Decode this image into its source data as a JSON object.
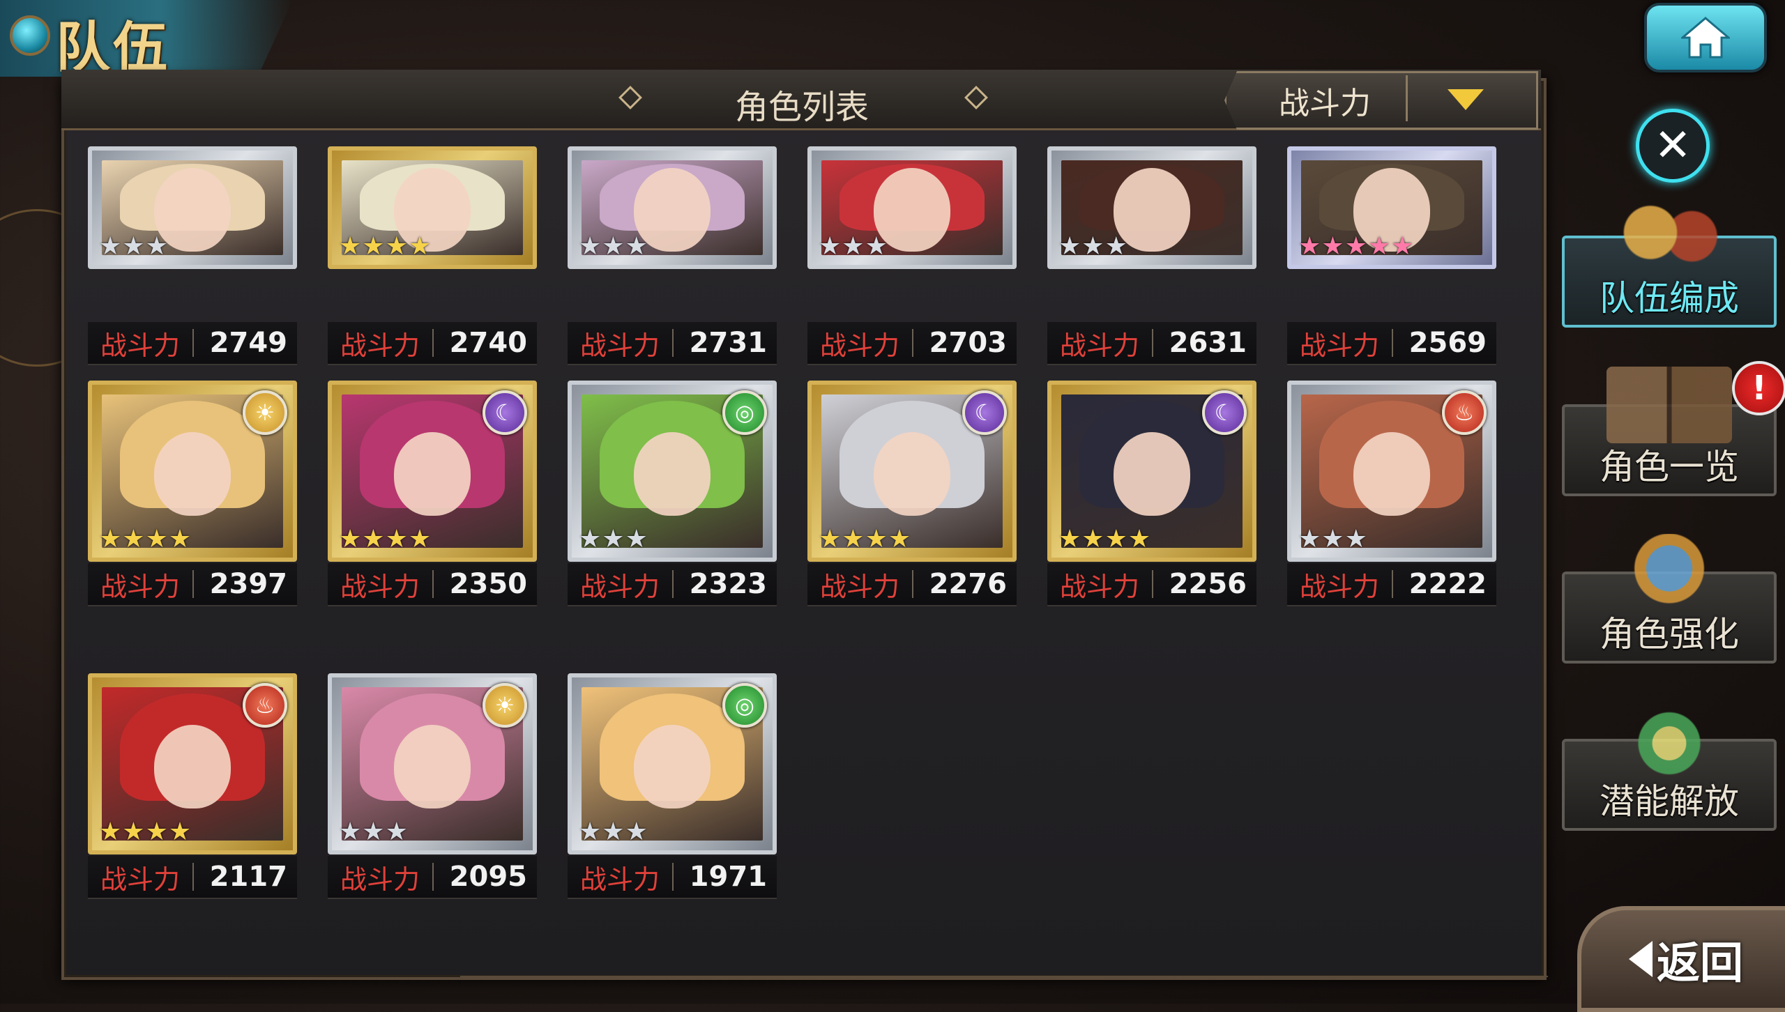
{
  "header": {
    "screen_title": "队伍",
    "list_title": "角色列表",
    "sort_label": "战斗力"
  },
  "power_label": "战斗力",
  "characters": [
    {
      "power": "2749",
      "rarity": 3,
      "frame": "silver",
      "element": null,
      "hair": "#e9d3b0"
    },
    {
      "power": "2740",
      "rarity": 4,
      "frame": "gold",
      "element": null,
      "hair": "#e8e2c8"
    },
    {
      "power": "2731",
      "rarity": 3,
      "frame": "silver",
      "element": null,
      "hair": "#c9a8c8"
    },
    {
      "power": "2703",
      "rarity": 3,
      "frame": "silver",
      "element": null,
      "hair": "#c8333a"
    },
    {
      "power": "2631",
      "rarity": 3,
      "frame": "silver",
      "element": null,
      "hair": "#4a2a22"
    },
    {
      "power": "2569",
      "rarity": 5,
      "frame": "rainbow",
      "element": null,
      "hair": "#5a4a3a"
    },
    {
      "power": "2397",
      "rarity": 4,
      "frame": "gold",
      "element": "sun",
      "hair": "#e8c27a"
    },
    {
      "power": "2350",
      "rarity": 4,
      "frame": "gold",
      "element": "moon",
      "hair": "#b8376f"
    },
    {
      "power": "2323",
      "rarity": 3,
      "frame": "silver",
      "element": "wind",
      "hair": "#7fbf4a"
    },
    {
      "power": "2276",
      "rarity": 4,
      "frame": "gold",
      "element": "moon",
      "hair": "#cfd0d6"
    },
    {
      "power": "2256",
      "rarity": 4,
      "frame": "gold",
      "element": "moon",
      "hair": "#2a2a3a"
    },
    {
      "power": "2222",
      "rarity": 3,
      "frame": "silver",
      "element": "fire",
      "hair": "#b8664a"
    },
    {
      "power": "2117",
      "rarity": 4,
      "frame": "gold",
      "element": "fire",
      "hair": "#c22a2a"
    },
    {
      "power": "2095",
      "rarity": 3,
      "frame": "silver",
      "element": "sun",
      "hair": "#d989a8"
    },
    {
      "power": "1971",
      "rarity": 3,
      "frame": "silver",
      "element": "wind",
      "hair": "#f0c27a"
    }
  ],
  "side_menu": {
    "team_edit": "队伍编成",
    "character_list": "角色一览",
    "character_enhance": "角色强化",
    "potential_unlock": "潜能解放",
    "alert_mark": "!"
  },
  "back_label": "返回",
  "colors": {
    "accent_cyan": "#3fe0ef",
    "power_red": "#e0413a",
    "sort_arrow": "#f1c93b"
  }
}
